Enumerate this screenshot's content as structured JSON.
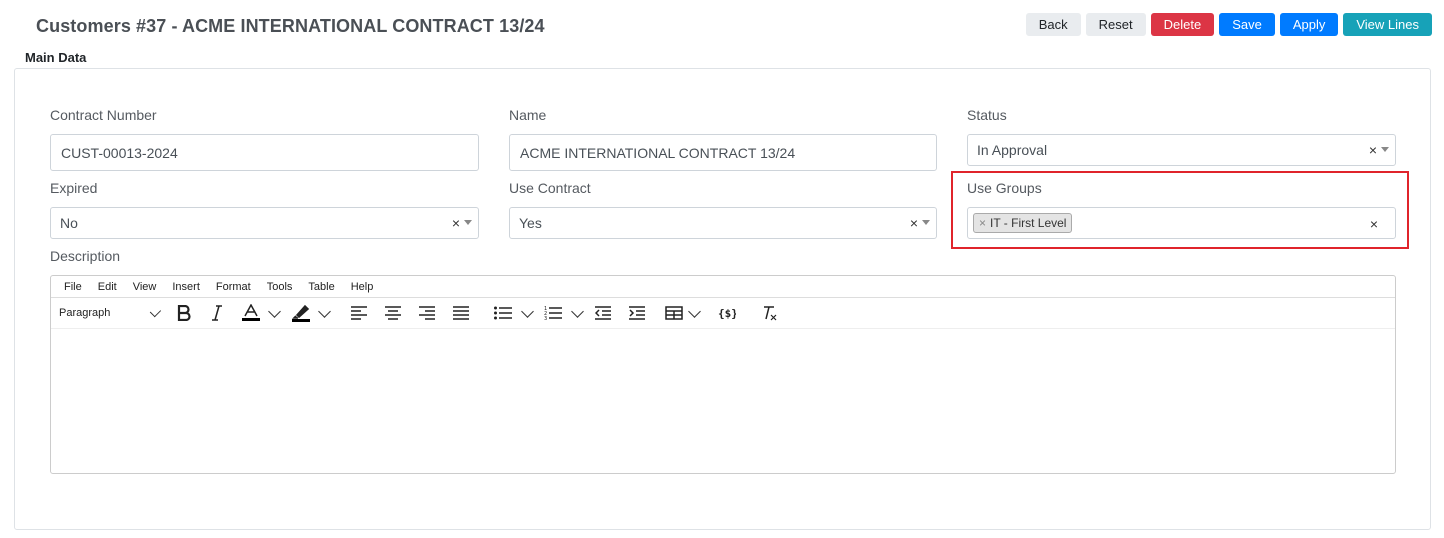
{
  "header": {
    "title": "Customers #37 - ACME INTERNATIONAL CONTRACT 13/24"
  },
  "toolbar": {
    "back": "Back",
    "reset": "Reset",
    "delete": "Delete",
    "save": "Save",
    "apply": "Apply",
    "view_lines": "View Lines"
  },
  "section": {
    "title": "Main Data"
  },
  "fields": {
    "contract_number": {
      "label": "Contract Number",
      "value": "CUST-00013-2024"
    },
    "name": {
      "label": "Name",
      "value": "ACME INTERNATIONAL CONTRACT 13/24"
    },
    "status": {
      "label": "Status",
      "value": "In Approval"
    },
    "expired": {
      "label": "Expired",
      "value": "No"
    },
    "use_contract": {
      "label": "Use Contract",
      "value": "Yes"
    },
    "use_groups": {
      "label": "Use Groups",
      "tags": [
        "IT - First Level"
      ]
    },
    "description": {
      "label": "Description"
    }
  },
  "editor": {
    "menu": [
      "File",
      "Edit",
      "View",
      "Insert",
      "Format",
      "Tools",
      "Table",
      "Help"
    ],
    "block_format": "Paragraph"
  },
  "colors": {
    "delete": "#dc3545",
    "primary": "#007bff",
    "info": "#17a2b8",
    "highlight": "#e0242b"
  }
}
